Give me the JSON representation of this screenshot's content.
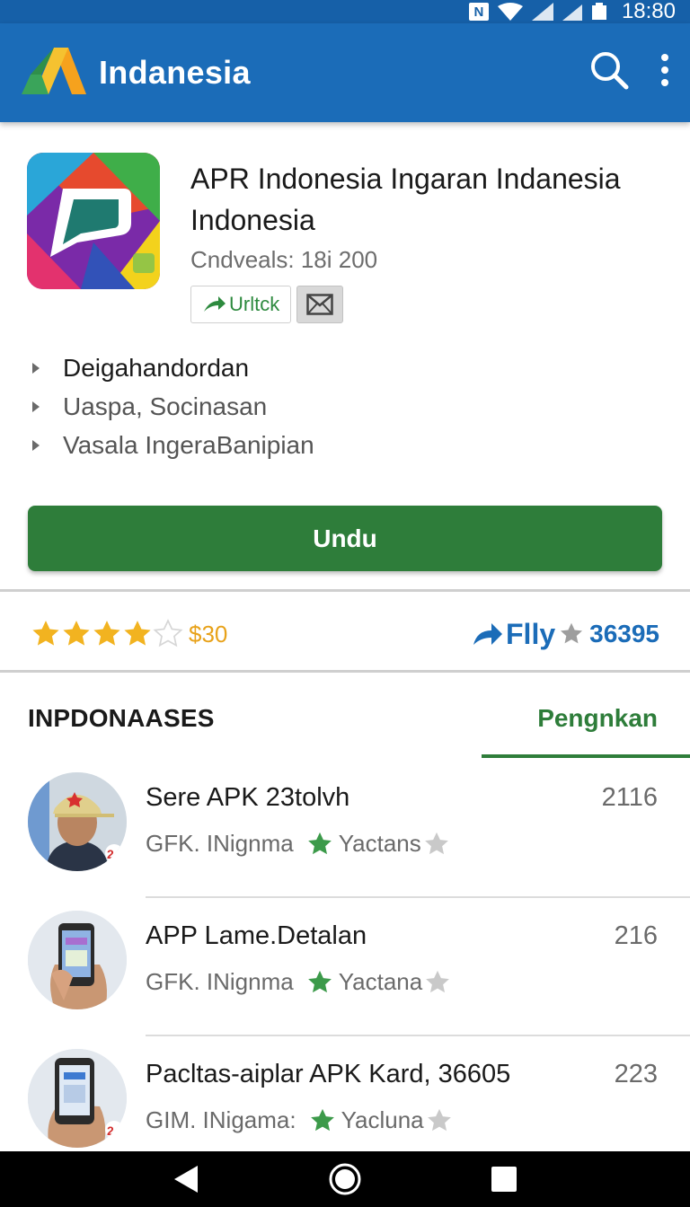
{
  "status_bar": {
    "time": "18:80",
    "indicator": "N"
  },
  "app_bar": {
    "title": "Indanesia",
    "icons": [
      "logo-icon",
      "search-icon",
      "more-vert-icon"
    ]
  },
  "app": {
    "name": "APR Indonesia Ingaran Indanesia Indonesia",
    "downloads": "Cndveals: 18i 200",
    "badge_label": "Urltck",
    "features": [
      "Deigahandordan",
      "Uaspa, Socinasan",
      "Vasala IngeraBanipian"
    ],
    "download_label": "Undu"
  },
  "rating": {
    "price": "$30",
    "stars": 4,
    "share_label": "Flly",
    "share_count": "36395"
  },
  "section": {
    "title": "INPDONAASES",
    "active_tab": "Pengnkan"
  },
  "list": [
    {
      "title": "Sere APK 23tolvh",
      "publisher": "GFK. INignma",
      "tag": "Yactans",
      "count": "2116"
    },
    {
      "title": "APP Lame.Detalan",
      "publisher": "GFK. INignma",
      "tag": "Yactana",
      "count": "216"
    },
    {
      "title": "Pacltas-aiplar APK Kard, 36605",
      "publisher": "GIM. INigama:",
      "tag": "Yacluna",
      "count": "223"
    }
  ],
  "colors": {
    "primary": "#1b6cb8",
    "accent_green": "#2e7d3a",
    "star": "#f2b320"
  }
}
